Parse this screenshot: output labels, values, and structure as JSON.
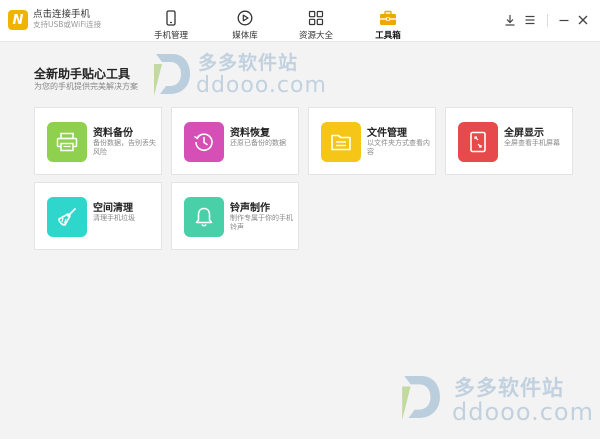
{
  "app": {
    "title": "点击连接手机",
    "subtitle": "支持USB或WiFi连接"
  },
  "nav": [
    {
      "label": "手机管理",
      "icon": "phone-icon"
    },
    {
      "label": "媒体库",
      "icon": "play-circle-icon"
    },
    {
      "label": "资源大全",
      "icon": "grid-icon"
    },
    {
      "label": "工具箱",
      "icon": "toolbox-icon"
    }
  ],
  "header": {
    "title": "全新助手贴心工具",
    "subtitle": "为您的手机提供完美解决方案"
  },
  "tools": [
    {
      "title": "资料备份",
      "desc": "备份数据，告别丢失风险",
      "icon": "printer-backup-icon",
      "color": "#8fd14f"
    },
    {
      "title": "资料恢复",
      "desc": "还原已备份的数据",
      "icon": "clock-restore-icon",
      "color": "#d54fb6"
    },
    {
      "title": "文件管理",
      "desc": "以文件夹方式查看内容",
      "icon": "folder-icon",
      "color": "#f5c518"
    },
    {
      "title": "全屏显示",
      "desc": "全屏查看手机屏幕",
      "icon": "fullscreen-phone-icon",
      "color": "#e64a4a"
    },
    {
      "title": "空间清理",
      "desc": "清理手机垃圾",
      "icon": "broom-icon",
      "color": "#2ed6cc"
    },
    {
      "title": "铃声制作",
      "desc": "制作专属于你的手机铃声",
      "icon": "bell-icon",
      "color": "#4ad0a9"
    }
  ],
  "watermark": {
    "cn": "多多软件站",
    "en": "ddooo.com"
  },
  "colors": {
    "logo": "#f0b400",
    "toolbox_active": "#f0a800"
  }
}
